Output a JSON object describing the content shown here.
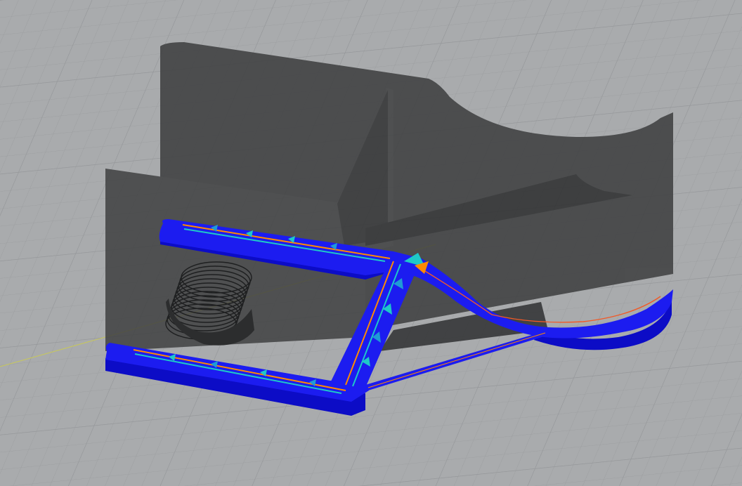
{
  "viewport": {
    "background_color": "#a9abad",
    "grid_color": "#9c9ea0",
    "grid_major_color": "#93959a",
    "axis_line_color": "#c8c85a"
  },
  "model": {
    "ghost_color": "#3c3d3e",
    "ghost_opacity": 0.82,
    "ghost_shadow_color": "#2a2b2c",
    "toolpath_wall_color": "#1a1aee",
    "toolpath_wall_side_color": "#0d0dc8",
    "toolpath_wall_highlight": "#3a3aff",
    "infill_colors": [
      "#ff8a00",
      "#1ec8c8",
      "#1f6fd6",
      "#f05a28"
    ]
  }
}
